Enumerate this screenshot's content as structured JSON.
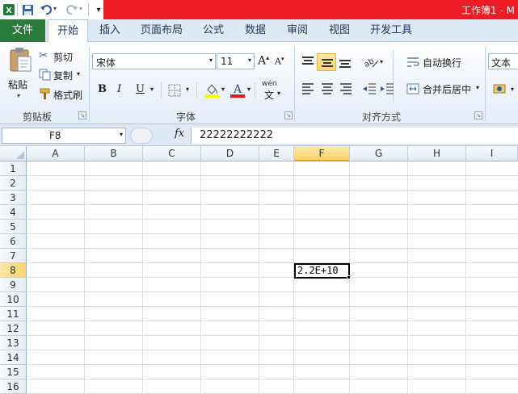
{
  "window": {
    "title": "工作簿1 - M"
  },
  "quick_access": {
    "app_icon": "excel-logo-icon",
    "save_icon": "save-icon",
    "undo_icon": "undo-icon",
    "redo_icon": "redo-icon",
    "customize_icon": "customize-quick-access-icon"
  },
  "tabs": [
    {
      "label": "文件"
    },
    {
      "label": "开始"
    },
    {
      "label": "插入"
    },
    {
      "label": "页面布局"
    },
    {
      "label": "公式"
    },
    {
      "label": "数据"
    },
    {
      "label": "审阅"
    },
    {
      "label": "视图"
    },
    {
      "label": "开发工具"
    }
  ],
  "ribbon": {
    "clipboard": {
      "label": "剪贴板",
      "paste": "粘贴",
      "cut": "剪切",
      "copy": "复制",
      "format_painter": "格式刷"
    },
    "font": {
      "label": "字体",
      "font_name": "宋体",
      "font_size": "11",
      "bold": "B",
      "italic": "I",
      "underline": "U",
      "grow": "A",
      "shrink": "A",
      "wen": "wén",
      "wen_char": "文"
    },
    "alignment": {
      "label": "对齐方式",
      "wrap_text": "自动换行",
      "merge_center": "合并后居中"
    },
    "number": {
      "format": "文本"
    }
  },
  "formula_bar": {
    "name_box": "F8",
    "fx": "fx",
    "content": "22222222222"
  },
  "columns": [
    "A",
    "B",
    "C",
    "D",
    "E",
    "F",
    "G",
    "H",
    "I"
  ],
  "rows": [
    "1",
    "2",
    "3",
    "4",
    "5",
    "6",
    "7",
    "8",
    "9",
    "10",
    "11",
    "12",
    "13",
    "14",
    "15",
    "16"
  ],
  "active_cell": {
    "ref": "F8",
    "display": "2.2E+10"
  },
  "accent_colors": {
    "title_red": "#ec1c24",
    "file_tab_green": "#2a7a3b",
    "selection_gold": "#f9d36f"
  }
}
